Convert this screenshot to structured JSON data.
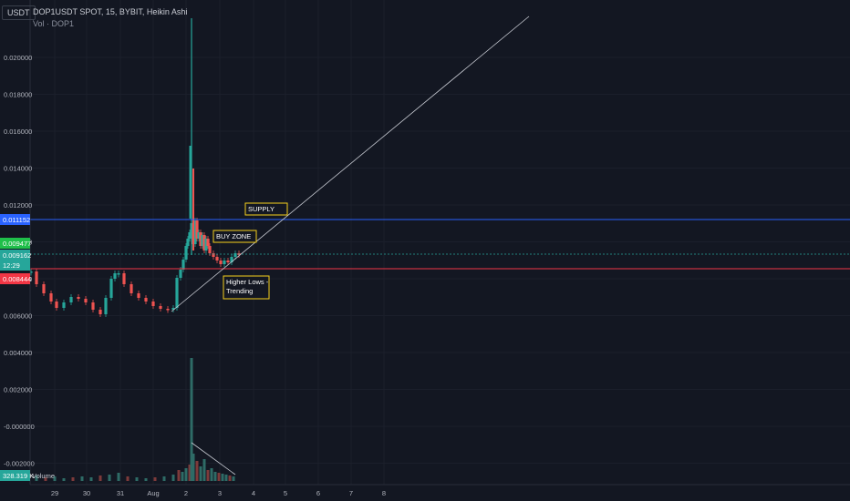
{
  "header": {
    "currency": "USDT",
    "symbol_line": "DOP1USDT SPOT, 15, BYBIT, Heikin Ashi",
    "volume_legend": "Vol · DOP1"
  },
  "price_axis": {
    "ticks": [
      "0.020000",
      "0.018000",
      "0.016000",
      "0.014000",
      "0.012000",
      "0.010000",
      "0.008000",
      "0.006000",
      "0.004000",
      "0.002000",
      "-0.000000",
      "-0.002000"
    ]
  },
  "price_markers": {
    "supply_line": {
      "label": "0.011152",
      "color": "#2962ff"
    },
    "high_tag": {
      "label": "0.009477",
      "color": "#1fbf4a"
    },
    "last": {
      "label": "0.009162",
      "countdown": "12:29",
      "color": "#26a69a"
    },
    "support_line": {
      "label": "0.008444",
      "color": "#f23645"
    }
  },
  "time_axis": {
    "labels": [
      "29",
      "30",
      "31",
      "Aug",
      "2",
      "3",
      "4",
      "5",
      "6",
      "7",
      "8"
    ]
  },
  "annotations": {
    "supply": "SUPPLY",
    "buy_zone": "BUY ZONE",
    "higher_lows": [
      "Higher Lows -",
      "Trending"
    ]
  },
  "volume_panel": {
    "value_tag": "328.319 K",
    "label": "Volume"
  },
  "colors": {
    "background": "#131722",
    "up": "#26a69a",
    "down": "#ef5350",
    "annotation_border": "#f7d11c",
    "trendline": "#c9ccd4"
  },
  "chart_data": {
    "type": "candlestick",
    "series_style": "Heikin Ashi",
    "interval": "15",
    "ylim": [
      -0.0027,
      0.0238
    ],
    "x_labels": [
      "29",
      "30",
      "31",
      "Aug",
      "2",
      "3",
      "4",
      "5",
      "6",
      "7",
      "8"
    ],
    "price_path": [
      [
        "28",
        0.0088
      ],
      [
        "29",
        0.0068
      ],
      [
        "29.5",
        0.0067
      ],
      [
        "30",
        0.0071
      ],
      [
        "30.5",
        0.0062
      ],
      [
        "31",
        0.0079
      ],
      [
        "31.5",
        0.0068
      ],
      [
        "Aug",
        0.0063
      ],
      [
        "1.5",
        0.006
      ],
      [
        "2",
        0.0093
      ],
      [
        "2 spike",
        0.0235
      ],
      [
        "2.3",
        0.0105
      ],
      [
        "2.6",
        0.0094
      ],
      [
        "3",
        0.0089
      ],
      [
        "3.4",
        0.0094
      ]
    ],
    "lines": [
      {
        "name": "supply",
        "value": 0.011152
      },
      {
        "name": "support",
        "value": 0.008444
      }
    ],
    "volume_last": "328.319 K"
  }
}
